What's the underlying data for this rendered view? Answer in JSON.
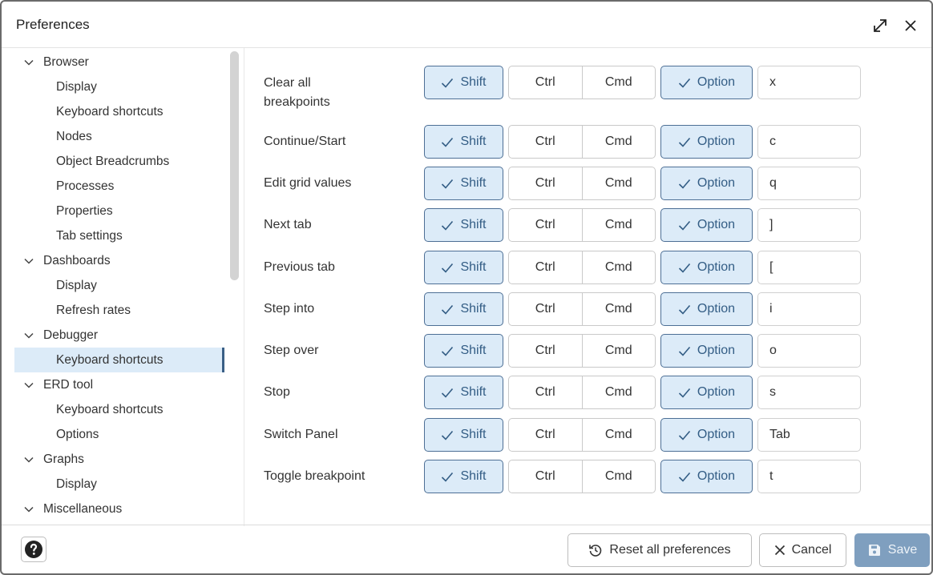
{
  "window": {
    "title": "Preferences"
  },
  "sidebar": {
    "items": [
      {
        "label": "Browser",
        "level": 0
      },
      {
        "label": "Display",
        "level": 1
      },
      {
        "label": "Keyboard shortcuts",
        "level": 1
      },
      {
        "label": "Nodes",
        "level": 1
      },
      {
        "label": "Object Breadcrumbs",
        "level": 1
      },
      {
        "label": "Processes",
        "level": 1
      },
      {
        "label": "Properties",
        "level": 1
      },
      {
        "label": "Tab settings",
        "level": 1
      },
      {
        "label": "Dashboards",
        "level": 0
      },
      {
        "label": "Display",
        "level": 1
      },
      {
        "label": "Refresh rates",
        "level": 1
      },
      {
        "label": "Debugger",
        "level": 0
      },
      {
        "label": "Keyboard shortcuts",
        "level": 1,
        "selected": true
      },
      {
        "label": "ERD tool",
        "level": 0
      },
      {
        "label": "Keyboard shortcuts",
        "level": 1
      },
      {
        "label": "Options",
        "level": 1
      },
      {
        "label": "Graphs",
        "level": 0
      },
      {
        "label": "Display",
        "level": 1
      },
      {
        "label": "Miscellaneous",
        "level": 0
      }
    ]
  },
  "modifiers": {
    "shift": "Shift",
    "ctrl": "Ctrl",
    "cmd": "Cmd",
    "option": "Option"
  },
  "shortcuts": [
    {
      "label": "Clear all breakpoints",
      "shift": true,
      "ctrl": false,
      "cmd": false,
      "option": true,
      "key": "x"
    },
    {
      "label": "Continue/Start",
      "shift": true,
      "ctrl": false,
      "cmd": false,
      "option": true,
      "key": "c"
    },
    {
      "label": "Edit grid values",
      "shift": true,
      "ctrl": false,
      "cmd": false,
      "option": true,
      "key": "q"
    },
    {
      "label": "Next tab",
      "shift": true,
      "ctrl": false,
      "cmd": false,
      "option": true,
      "key": "]"
    },
    {
      "label": "Previous tab",
      "shift": true,
      "ctrl": false,
      "cmd": false,
      "option": true,
      "key": "["
    },
    {
      "label": "Step into",
      "shift": true,
      "ctrl": false,
      "cmd": false,
      "option": true,
      "key": "i"
    },
    {
      "label": "Step over",
      "shift": true,
      "ctrl": false,
      "cmd": false,
      "option": true,
      "key": "o"
    },
    {
      "label": "Stop",
      "shift": true,
      "ctrl": false,
      "cmd": false,
      "option": true,
      "key": "s"
    },
    {
      "label": "Switch Panel",
      "shift": true,
      "ctrl": false,
      "cmd": false,
      "option": true,
      "key": "Tab"
    },
    {
      "label": "Toggle breakpoint",
      "shift": true,
      "ctrl": false,
      "cmd": false,
      "option": true,
      "key": "t"
    }
  ],
  "footer": {
    "reset_label": "Reset all preferences",
    "cancel_label": "Cancel",
    "save_label": "Save"
  },
  "colors": {
    "accent": "#dcebf8",
    "accent_border": "#4d6f95",
    "save_button": "#7f9fbf"
  },
  "icons": {
    "expand": "expand-icon",
    "close": "close-icon",
    "help": "help-icon",
    "reset": "reset-icon",
    "cancel": "cancel-icon",
    "save": "save-icon",
    "check": "check-icon",
    "chevron": "chevron-down-icon"
  }
}
